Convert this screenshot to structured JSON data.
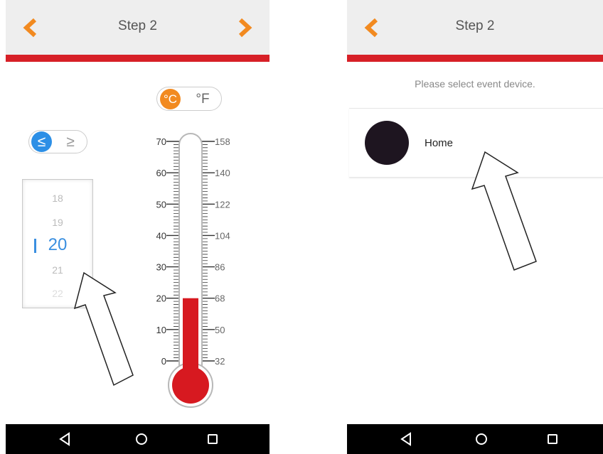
{
  "left_screen": {
    "header": {
      "title": "Step 2",
      "back_icon": "chevron-left-icon",
      "next_icon": "chevron-right-icon"
    },
    "unit_toggle": {
      "celsius": "°C",
      "fahrenheit": "°F",
      "selected": "celsius"
    },
    "comparison_toggle": {
      "less_equal": "≤",
      "greater_equal": "≥",
      "selected": "less_equal"
    },
    "picker": {
      "items": [
        "18",
        "19",
        "20",
        "21",
        "22"
      ],
      "selected": "20"
    },
    "thermometer": {
      "celsius_ticks": [
        "70",
        "60",
        "50",
        "40",
        "30",
        "20",
        "10",
        "0"
      ],
      "fahrenheit_ticks": [
        "158",
        "140",
        "122",
        "104",
        "86",
        "68",
        "50",
        "32"
      ],
      "level_celsius": 20,
      "scale_min": 0,
      "scale_max": 70
    }
  },
  "right_screen": {
    "header": {
      "title": "Step 2",
      "back_icon": "chevron-left-icon"
    },
    "prompt": "Please select event device.",
    "devices": [
      {
        "name": "Home",
        "icon": "avatar"
      }
    ]
  },
  "nav_bar": {
    "back_icon": "triangle-back-icon",
    "home_icon": "circle-home-icon",
    "recents_icon": "square-recents-icon"
  },
  "colors": {
    "accent_orange": "#f28a20",
    "header_red": "#d72027",
    "toggle_blue": "#2c8fe6",
    "mercury_red": "#d71920"
  }
}
